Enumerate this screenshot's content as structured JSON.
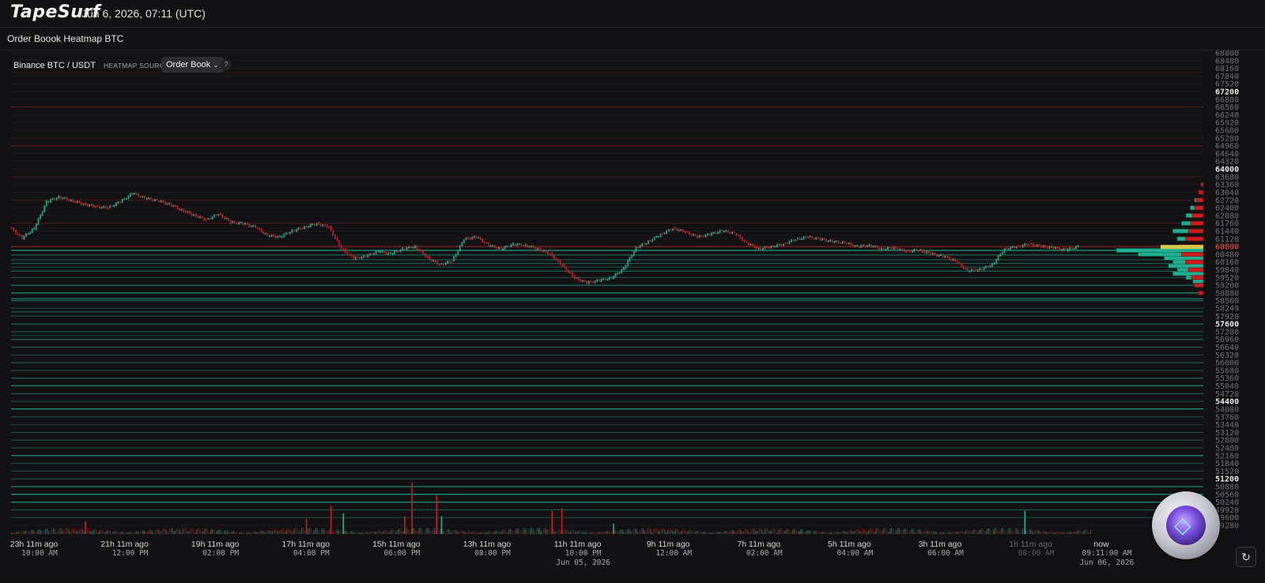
{
  "app": {
    "logo": "TapeSurf",
    "datetime": "Jun 6, 2026, 07:11 (UTC)",
    "page_title": "Order Boook Heatmap BTC"
  },
  "controls": {
    "pair": "Binance BTC / USDT",
    "heatmap_source_label": "HEATMAP SOURCE",
    "heatmap_source_value": "Order Book",
    "help": "?"
  },
  "colors": {
    "background": "#121215",
    "bid": "#1fae8f",
    "ask": "#d11a1a",
    "price_line": "#c62828",
    "current_level": "#d4c84a"
  },
  "icons": {
    "select": "chevron-down-icon",
    "help": "question-icon",
    "refresh": "refresh-icon",
    "badge": "crypto-coin-badge-icon"
  },
  "chart_data": {
    "type": "heatmap",
    "ylim": [
      49280,
      68800
    ],
    "y_ticks": [
      "68800",
      "68480",
      "68160",
      "67840",
      "67520",
      "67200",
      "66880",
      "66560",
      "66240",
      "65920",
      "65600",
      "65280",
      "64960",
      "64640",
      "64320",
      "64000",
      "63680",
      "63360",
      "63040",
      "62720",
      "62400",
      "62080",
      "61760",
      "61440",
      "61120",
      "60800",
      "60480",
      "60160",
      "59840",
      "59520",
      "59200",
      "58880",
      "58560",
      "58249",
      "57920",
      "57600",
      "57280",
      "56960",
      "56640",
      "56320",
      "56000",
      "55680",
      "55360",
      "55040",
      "54720",
      "54400",
      "54080",
      "53760",
      "53440",
      "53120",
      "52800",
      "52480",
      "52160",
      "51840",
      "51520",
      "51200",
      "50880",
      "50560",
      "50240",
      "49920",
      "49600",
      "49280"
    ],
    "bold_ticks": [
      "67200",
      "64000",
      "57600",
      "54400",
      "51200"
    ],
    "current_price": "60800",
    "x_ticks": [
      {
        "rel": "23h 11m ago",
        "time": "10:00 AM",
        "date": ""
      },
      {
        "rel": "21h 11m ago",
        "time": "12:00 PM",
        "date": ""
      },
      {
        "rel": "19h 11m ago",
        "time": "02:00 PM",
        "date": ""
      },
      {
        "rel": "17h 11m ago",
        "time": "04:00 PM",
        "date": ""
      },
      {
        "rel": "15h 11m ago",
        "time": "06:00 PM",
        "date": ""
      },
      {
        "rel": "13h 11m ago",
        "time": "08:00 PM",
        "date": ""
      },
      {
        "rel": "11h 11m ago",
        "time": "10:00 PM",
        "date": "Jun 05, 2026"
      },
      {
        "rel": "9h 11m ago",
        "time": "12:00 AM",
        "date": ""
      },
      {
        "rel": "7h 11m ago",
        "time": "02:00 AM",
        "date": ""
      },
      {
        "rel": "5h 11m ago",
        "time": "04:00 AM",
        "date": ""
      },
      {
        "rel": "3h 11m ago",
        "time": "06:00 AM",
        "date": ""
      },
      {
        "rel": "1h 11m ago",
        "time": "08:00 AM",
        "date": ""
      },
      {
        "rel": "now",
        "time": "09:11:00 AM",
        "date": "Jun 06, 2026"
      }
    ],
    "price_path": [
      [
        0,
        61600
      ],
      [
        1,
        61150
      ],
      [
        2,
        61550
      ],
      [
        3,
        62650
      ],
      [
        4,
        62850
      ],
      [
        5,
        62700
      ],
      [
        6,
        62550
      ],
      [
        7,
        62450
      ],
      [
        8,
        62400
      ],
      [
        9,
        62650
      ],
      [
        10,
        63000
      ],
      [
        11,
        62800
      ],
      [
        12,
        62700
      ],
      [
        13,
        62550
      ],
      [
        14,
        62300
      ],
      [
        15,
        62100
      ],
      [
        16,
        61900
      ],
      [
        17,
        62150
      ],
      [
        18,
        61800
      ],
      [
        19,
        61750
      ],
      [
        20,
        61600
      ],
      [
        21,
        61250
      ],
      [
        22,
        61200
      ],
      [
        23,
        61450
      ],
      [
        24,
        61600
      ],
      [
        25,
        61750
      ],
      [
        26,
        61600
      ],
      [
        27,
        60700
      ],
      [
        28,
        60300
      ],
      [
        29,
        60400
      ],
      [
        30,
        60600
      ],
      [
        31,
        60500
      ],
      [
        32,
        60700
      ],
      [
        33,
        60800
      ],
      [
        34,
        60350
      ],
      [
        35,
        60050
      ],
      [
        36,
        60200
      ],
      [
        37,
        61100
      ],
      [
        38,
        61200
      ],
      [
        39,
        60850
      ],
      [
        40,
        60700
      ],
      [
        41,
        60900
      ],
      [
        42,
        60850
      ],
      [
        43,
        60700
      ],
      [
        44,
        60500
      ],
      [
        45,
        60000
      ],
      [
        46,
        59500
      ],
      [
        47,
        59300
      ],
      [
        48,
        59400
      ],
      [
        49,
        59500
      ],
      [
        50,
        59900
      ],
      [
        51,
        60750
      ],
      [
        52,
        61000
      ],
      [
        53,
        61300
      ],
      [
        54,
        61550
      ],
      [
        55,
        61400
      ],
      [
        56,
        61200
      ],
      [
        57,
        61300
      ],
      [
        58,
        61450
      ],
      [
        59,
        61350
      ],
      [
        60,
        60950
      ],
      [
        61,
        60700
      ],
      [
        62,
        60800
      ],
      [
        63,
        60900
      ],
      [
        64,
        61100
      ],
      [
        65,
        61200
      ],
      [
        66,
        61100
      ],
      [
        67,
        61000
      ],
      [
        68,
        60950
      ],
      [
        69,
        60800
      ],
      [
        70,
        60850
      ],
      [
        71,
        60700
      ],
      [
        72,
        60750
      ],
      [
        73,
        60600
      ],
      [
        74,
        60650
      ],
      [
        75,
        60500
      ],
      [
        76,
        60400
      ],
      [
        77,
        60200
      ],
      [
        78,
        59800
      ],
      [
        79,
        59850
      ],
      [
        80,
        60050
      ],
      [
        81,
        60700
      ],
      [
        82,
        60800
      ],
      [
        83,
        60900
      ],
      [
        84,
        60800
      ],
      [
        85,
        60750
      ],
      [
        86,
        60650
      ],
      [
        87,
        60800
      ]
    ],
    "bid_levels": [
      {
        "price": 60640,
        "strength": 0.9
      },
      {
        "price": 60450,
        "strength": 0.55
      },
      {
        "price": 60250,
        "strength": 0.5
      },
      {
        "price": 60100,
        "strength": 0.45
      },
      {
        "price": 59950,
        "strength": 0.4
      },
      {
        "price": 59780,
        "strength": 0.55
      },
      {
        "price": 59520,
        "strength": 0.4
      },
      {
        "price": 59200,
        "strength": 0.6
      },
      {
        "price": 58880,
        "strength": 0.85
      },
      {
        "price": 58640,
        "strength": 0.7
      },
      {
        "price": 58560,
        "strength": 0.6
      },
      {
        "price": 58250,
        "strength": 0.35
      },
      {
        "price": 58100,
        "strength": 0.55
      },
      {
        "price": 57930,
        "strength": 0.35
      },
      {
        "price": 57600,
        "strength": 0.55
      },
      {
        "price": 57280,
        "strength": 0.45
      },
      {
        "price": 57120,
        "strength": 0.3
      },
      {
        "price": 56960,
        "strength": 0.5
      },
      {
        "price": 56640,
        "strength": 0.4
      },
      {
        "price": 56320,
        "strength": 0.3
      },
      {
        "price": 56000,
        "strength": 0.45
      },
      {
        "price": 55680,
        "strength": 0.4
      },
      {
        "price": 55360,
        "strength": 0.5
      },
      {
        "price": 55050,
        "strength": 0.75
      },
      {
        "price": 54720,
        "strength": 0.45
      },
      {
        "price": 54400,
        "strength": 0.3
      },
      {
        "price": 54090,
        "strength": 0.85
      },
      {
        "price": 53760,
        "strength": 0.3
      },
      {
        "price": 53440,
        "strength": 0.25
      },
      {
        "price": 53120,
        "strength": 0.35
      },
      {
        "price": 52800,
        "strength": 0.4
      },
      {
        "price": 52480,
        "strength": 0.3
      },
      {
        "price": 52160,
        "strength": 0.8
      },
      {
        "price": 51840,
        "strength": 0.3
      },
      {
        "price": 51520,
        "strength": 0.3
      },
      {
        "price": 51200,
        "strength": 0.4
      },
      {
        "price": 50880,
        "strength": 0.75
      },
      {
        "price": 50560,
        "strength": 0.9
      },
      {
        "price": 50240,
        "strength": 0.8
      },
      {
        "price": 49920,
        "strength": 0.4
      },
      {
        "price": 49600,
        "strength": 0.3
      }
    ],
    "ask_levels": [
      {
        "price": 68000,
        "strength": 0.15
      },
      {
        "price": 66560,
        "strength": 0.35
      },
      {
        "price": 65280,
        "strength": 0.2
      },
      {
        "price": 64960,
        "strength": 0.45
      },
      {
        "price": 63680,
        "strength": 0.2
      },
      {
        "price": 62720,
        "strength": 0.25
      },
      {
        "price": 61760,
        "strength": 0.3
      }
    ],
    "bid_depth": [
      {
        "price": 60640,
        "size": 1.0
      },
      {
        "price": 60480,
        "size": 0.75
      },
      {
        "price": 60320,
        "size": 0.45
      },
      {
        "price": 60160,
        "size": 0.35
      },
      {
        "price": 60000,
        "size": 0.4
      },
      {
        "price": 59840,
        "size": 0.3
      },
      {
        "price": 59680,
        "size": 0.35
      },
      {
        "price": 59520,
        "size": 0.2
      },
      {
        "price": 59360,
        "size": 0.12
      },
      {
        "price": 59200,
        "size": 0.1
      },
      {
        "price": 61120,
        "size": 0.3
      },
      {
        "price": 61440,
        "size": 0.35
      },
      {
        "price": 61760,
        "size": 0.25
      },
      {
        "price": 62080,
        "size": 0.2
      },
      {
        "price": 62400,
        "size": 0.15
      },
      {
        "price": 62720,
        "size": 0.1
      },
      {
        "price": 63040,
        "size": 0.05
      }
    ],
    "ask_depth": [
      {
        "price": 60800,
        "size": 0.6
      },
      {
        "price": 61120,
        "size": 0.45
      },
      {
        "price": 61440,
        "size": 0.38
      },
      {
        "price": 61760,
        "size": 0.32
      },
      {
        "price": 62080,
        "size": 0.28
      },
      {
        "price": 62400,
        "size": 0.22
      },
      {
        "price": 62720,
        "size": 0.18
      },
      {
        "price": 63040,
        "size": 0.12
      },
      {
        "price": 63360,
        "size": 0.06
      },
      {
        "price": 60480,
        "size": 0.55
      },
      {
        "price": 60160,
        "size": 0.45
      },
      {
        "price": 59840,
        "size": 0.38
      },
      {
        "price": 59520,
        "size": 0.3
      },
      {
        "price": 59200,
        "size": 0.22
      },
      {
        "price": 58880,
        "size": 0.12
      }
    ],
    "volume_spikes": [
      {
        "t": 6,
        "v": 0.25,
        "side": "sell"
      },
      {
        "t": 24,
        "v": 0.3,
        "side": "sell"
      },
      {
        "t": 26,
        "v": 0.55,
        "side": "sell"
      },
      {
        "t": 27,
        "v": 0.4,
        "side": "buy"
      },
      {
        "t": 32,
        "v": 0.35,
        "side": "sell"
      },
      {
        "t": 32.6,
        "v": 1.0,
        "side": "sell"
      },
      {
        "t": 34.6,
        "v": 0.75,
        "side": "sell"
      },
      {
        "t": 35,
        "v": 0.35,
        "side": "buy"
      },
      {
        "t": 44,
        "v": 0.45,
        "side": "sell"
      },
      {
        "t": 44.8,
        "v": 0.5,
        "side": "sell"
      },
      {
        "t": 49,
        "v": 0.2,
        "side": "buy"
      },
      {
        "t": 82.5,
        "v": 0.45,
        "side": "buy"
      }
    ],
    "legend": "none",
    "grid": true
  }
}
